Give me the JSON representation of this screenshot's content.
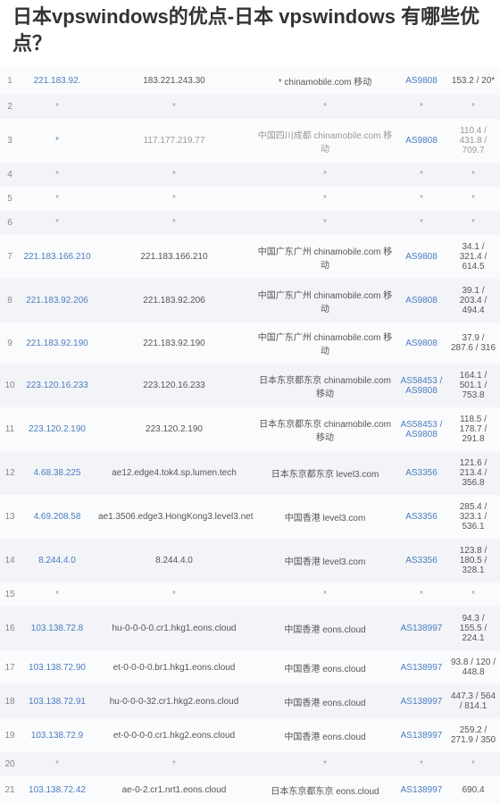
{
  "title": "日本vpswindows的优点-日本 vpswindows 有哪些优点？",
  "rows": [
    {
      "n": 1,
      "ip": "221.183.92.",
      "ip_link": true,
      "host": "183.221.243.30",
      "loc": "* chinamobile.com 移动",
      "asn": "AS9808",
      "asn_link": true,
      "time": "153.2 / 20*"
    },
    {
      "n": 2,
      "ip": "*",
      "host": "*",
      "loc": "*",
      "asn": "*",
      "time": "*"
    },
    {
      "n": 3,
      "ip": "*",
      "ip_link": true,
      "host": "117.177.219.77",
      "loc": "中国四川成都 chinamobile.com 移动",
      "asn": "AS9808",
      "asn_link": true,
      "time": "110.4 / 431.8 / 709.7"
    },
    {
      "n": 4,
      "ip": "*",
      "host": "*",
      "loc": "*",
      "asn": "*",
      "time": "*"
    },
    {
      "n": 5,
      "ip": "*",
      "host": "*",
      "loc": "*",
      "asn": "*",
      "time": "*"
    },
    {
      "n": 6,
      "ip": "*",
      "host": "*",
      "loc": "*",
      "asn": "*",
      "time": "*"
    },
    {
      "n": 7,
      "ip": "221.183.166.210",
      "ip_link": true,
      "host": "221.183.166.210",
      "loc": "中国广东广州 chinamobile.com 移动",
      "asn": "AS9808",
      "asn_link": true,
      "time": "34.1 / 321.4 / 614.5"
    },
    {
      "n": 8,
      "ip": "221.183.92.206",
      "ip_link": true,
      "host": "221.183.92.206",
      "loc": "中国广东广州 chinamobile.com 移动",
      "asn": "AS9808",
      "asn_link": true,
      "time": "39.1 / 203.4 / 494.4"
    },
    {
      "n": 9,
      "ip": "221.183.92.190",
      "ip_link": true,
      "host": "221.183.92.190",
      "loc": "中国广东广州 chinamobile.com 移动",
      "asn": "AS9808",
      "asn_link": true,
      "time": "37.9 / 287.6 / 316"
    },
    {
      "n": 10,
      "ip": "223.120.16.233",
      "ip_link": true,
      "host": "223.120.16.233",
      "loc": "日本东京都东京 chinamobile.com 移动",
      "asn": "AS58453 / AS9808",
      "asn_link": true,
      "time": "164.1 / 501.1 / 753.8"
    },
    {
      "n": 11,
      "ip": "223.120.2.190",
      "ip_link": true,
      "host": "223.120.2.190",
      "loc": "日本东京都东京 chinamobile.com 移动",
      "asn": "AS58453 / AS9808",
      "asn_link": true,
      "time": "118.5 / 178.7 / 291.8"
    },
    {
      "n": 12,
      "ip": "4.68.38.225",
      "ip_link": true,
      "host": "ae12.edge4.tok4.sp.lumen.tech",
      "loc": "日本东京都东京 level3.com",
      "asn": "AS3356",
      "asn_link": true,
      "time": "121.6 / 213.4 / 356.8"
    },
    {
      "n": 13,
      "ip": "4.69.208.58",
      "ip_link": true,
      "host": "ae1.3506.edge3.HongKong3.level3.net",
      "loc": "中国香港 level3.com",
      "asn": "AS3356",
      "asn_link": true,
      "time": "285.4 / 323.1 / 536.1"
    },
    {
      "n": 14,
      "ip": "8.244.4.0",
      "ip_link": true,
      "host": "8.244.4.0",
      "loc": "中国香港 level3.com",
      "asn": "AS3356",
      "asn_link": true,
      "time": "123.8 / 180.5 / 328.1"
    },
    {
      "n": 15,
      "ip": "*",
      "host": "*",
      "loc": "*",
      "asn": "*",
      "time": "*"
    },
    {
      "n": 16,
      "ip": "103.138.72.8",
      "ip_link": true,
      "host": "hu-0-0-0-0.cr1.hkg1.eons.cloud",
      "loc": "中国香港 eons.cloud",
      "asn": "AS138997",
      "asn_link": true,
      "time": "94.3 / 155.5 / 224.1"
    },
    {
      "n": 17,
      "ip": "103.138.72.90",
      "ip_link": true,
      "host": "et-0-0-0-0.br1.hkg1.eons.cloud",
      "loc": "中国香港 eons.cloud",
      "asn": "AS138997",
      "asn_link": true,
      "time": "93.8 / 120 / 448.8"
    },
    {
      "n": 18,
      "ip": "103.138.72.91",
      "ip_link": true,
      "host": "hu-0-0-0-32.cr1.hkg2.eons.cloud",
      "loc": "中国香港 eons.cloud",
      "asn": "AS138997",
      "asn_link": true,
      "time": "447.3 / 564 / 814.1"
    },
    {
      "n": 19,
      "ip": "103.138.72.9",
      "ip_link": true,
      "host": "et-0-0-0-0.cr1.hkg2.eons.cloud",
      "loc": "中国香港 eons.cloud",
      "asn": "AS138997",
      "asn_link": true,
      "time": "259.2 / 271.9 / 350"
    },
    {
      "n": 20,
      "ip": "*",
      "host": "*",
      "loc": "*",
      "asn": "*",
      "time": "*"
    },
    {
      "n": 21,
      "ip": "103.138.72.42",
      "ip_link": true,
      "host": "ae-0-2.cr1.nrt1.eons.cloud",
      "loc": "日本东京都东京 eons.cloud",
      "asn": "AS138997",
      "asn_link": true,
      "time": "690.4"
    }
  ]
}
